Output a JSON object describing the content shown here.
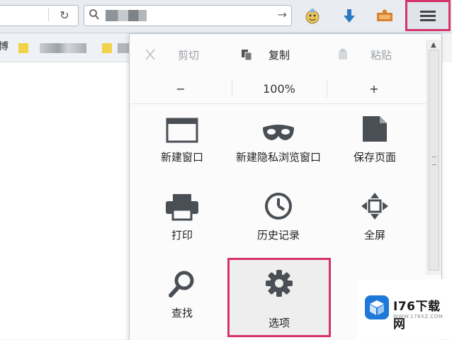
{
  "toolbar": {
    "reload_icon": "reload-icon",
    "search_icon": "search-icon",
    "go_icon": "arrow-right-icon",
    "icons": [
      "addon-face-icon",
      "download-arrow-icon",
      "puzzle-addon-icon"
    ],
    "menu_icon": "hamburger-menu-icon",
    "menu_highlight_color": "#d6336c"
  },
  "bookmarks": {
    "first_char": "博"
  },
  "menu": {
    "edit": {
      "cut": "剪切",
      "copy": "复制",
      "paste": "粘贴"
    },
    "zoom": {
      "minus": "−",
      "level": "100%",
      "plus": "+"
    },
    "items": [
      {
        "label": "新建窗口",
        "icon": "window-icon"
      },
      {
        "label": "新建隐私浏览窗口",
        "icon": "private-mask-icon"
      },
      {
        "label": "保存页面",
        "icon": "save-page-icon"
      },
      {
        "label": "打印",
        "icon": "printer-icon"
      },
      {
        "label": "历史记录",
        "icon": "history-clock-icon"
      },
      {
        "label": "全屏",
        "icon": "fullscreen-icon"
      },
      {
        "label": "查找",
        "icon": "find-magnifier-icon"
      },
      {
        "label": "选项",
        "icon": "options-gear-icon"
      }
    ],
    "highlighted_item": "选项"
  },
  "watermark": {
    "text": "I76下载网",
    "sub": "WWW.176XZ.COM"
  }
}
